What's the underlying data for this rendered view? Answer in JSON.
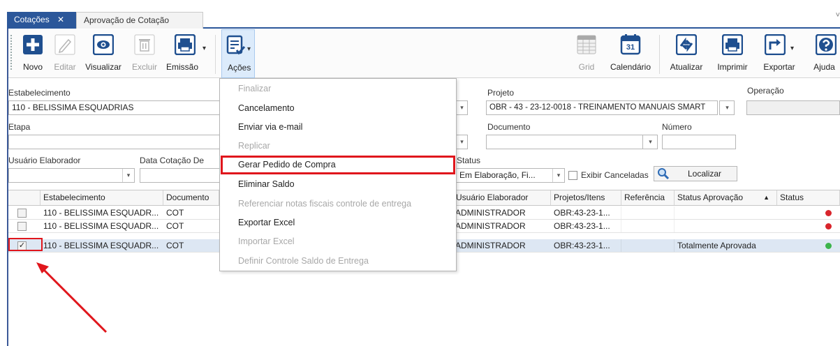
{
  "tabs": [
    {
      "label": "Cotações",
      "close": "✕"
    },
    {
      "label": "Aprovação de Cotação"
    }
  ],
  "tabbar_chevron": "˅",
  "toolbar": {
    "novo": "Novo",
    "editar": "Editar",
    "visualizar": "Visualizar",
    "excluir": "Excluir",
    "emissao": "Emissão",
    "acoes": "Ações",
    "grid": "Grid",
    "calendario": "Calendário",
    "calendario_day": "31",
    "atualizar": "Atualizar",
    "imprimir": "Imprimir",
    "exportar": "Exportar",
    "ajuda": "Ajuda"
  },
  "filters": {
    "estabelecimento_label": "Estabelecimento",
    "estabelecimento_value": "110 - BELISSIMA ESQUADRIAS",
    "projeto_label": "Projeto",
    "projeto_value": "OBR - 43 - 23-12-0018 - TREINAMENTO MANUAIS SMART",
    "operacao_label": "Operação",
    "etapa_label": "Etapa",
    "documento_label": "Documento",
    "numero_label": "Número",
    "usuario_label": "Usuário Elaborador",
    "data_label": "Data Cotação De",
    "status_label": "Status",
    "status_value": "Em Elaboração, Fi...",
    "exibir_canceladas": "Exibir Canceladas",
    "localizar": "Localizar"
  },
  "grid": {
    "columns": [
      "Estabelecimento",
      "Documento",
      "Usuário Elaborador",
      "Projetos/Itens",
      "Referência",
      "Status Aprovação",
      "Status"
    ],
    "sort_arrow": "▲",
    "rows": [
      {
        "checked": false,
        "checkmark": "",
        "estabelecimento": "110 - BELISSIMA ESQUADR...",
        "documento": "COT",
        "usuario": "ADMINISTRADOR",
        "projetos": "OBR:43-23-1...",
        "referencia": "",
        "status_aprovacao": "",
        "status_color": "#d9252c"
      },
      {
        "checked": false,
        "checkmark": "",
        "estabelecimento": "110 - BELISSIMA ESQUADR...",
        "documento": "COT",
        "usuario": "ADMINISTRADOR",
        "projetos": "OBR:43-23-1...",
        "referencia": "",
        "status_aprovacao": "",
        "status_color": "#d9252c"
      },
      {
        "checked": true,
        "checkmark": "✓",
        "estabelecimento": "110 - BELISSIMA ESQUADR...",
        "documento": "COT",
        "usuario": "ADMINISTRADOR",
        "projetos": "OBR:43-23-1...",
        "referencia": "",
        "status_aprovacao": "Totalmente Aprovada",
        "status_color": "#3cb44b"
      }
    ]
  },
  "menu": {
    "items": [
      {
        "label": "Finalizar",
        "enabled": false
      },
      {
        "label": "Cancelamento",
        "enabled": true
      },
      {
        "label": "Enviar via e-mail",
        "enabled": true
      },
      {
        "label": "Replicar",
        "enabled": false
      },
      {
        "label": "Gerar Pedido de Compra",
        "enabled": true
      },
      {
        "label": "Eliminar Saldo",
        "enabled": true
      },
      {
        "label": "Referenciar notas fiscais controle de entrega",
        "enabled": false
      },
      {
        "label": "Exportar Excel",
        "enabled": true
      },
      {
        "label": "Importar Excel",
        "enabled": false
      },
      {
        "label": "Definir Controle Saldo de Entrega",
        "enabled": false
      }
    ]
  },
  "colors": {
    "accent": "#2b579a",
    "annotation_red": "#e0161c",
    "status_red": "#d9252c",
    "status_green": "#3cb44b"
  }
}
